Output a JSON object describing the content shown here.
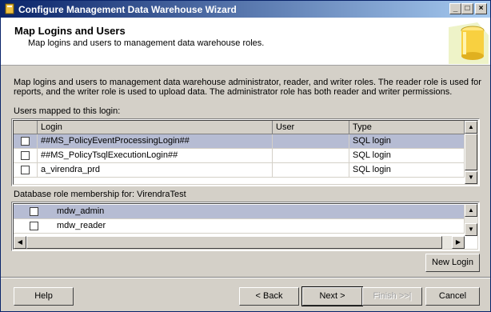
{
  "window": {
    "title": "Configure Management Data Warehouse Wizard",
    "controls": {
      "minimize": "_",
      "maximize": "□",
      "close": "×"
    }
  },
  "header": {
    "title": "Map Logins and Users",
    "subtitle": "Map logins and users to management data warehouse roles."
  },
  "description": "Map logins and users to management data warehouse administrator, reader, and writer roles. The reader role is used for reports, and the writer role is used to upload data. The administrator role has both reader and writer permissions.",
  "users_section": {
    "label": "Users mapped to this login:",
    "columns": [
      "",
      "Login",
      "User",
      "Type"
    ],
    "rows": [
      {
        "checked": false,
        "login": "##MS_PolicyEventProcessingLogin##",
        "user": "",
        "type": "SQL login",
        "selected": true
      },
      {
        "checked": false,
        "login": "##MS_PolicyTsqlExecutionLogin##",
        "user": "",
        "type": "SQL login",
        "selected": false
      },
      {
        "checked": false,
        "login": "a_virendra_prd",
        "user": "",
        "type": "SQL login",
        "selected": false
      }
    ]
  },
  "roles_section": {
    "label": "Database role membership for: VirendraTest",
    "rows": [
      {
        "checked": false,
        "role": "mdw_admin",
        "selected": true
      },
      {
        "checked": false,
        "role": "mdw_reader",
        "selected": false
      }
    ]
  },
  "buttons": {
    "new_login": "New Login",
    "help": "Help",
    "back": "< Back",
    "next": "Next >",
    "finish": "Finish >>|",
    "cancel": "Cancel"
  },
  "colors": {
    "titlebar_start": "#0a246a",
    "titlebar_end": "#a6caf0",
    "selection": "#b6bcd3",
    "dialog_bg": "#d4d0c8"
  },
  "icons": [
    "app-icon",
    "warehouse-cylinder-icon",
    "scroll-up-icon",
    "scroll-down-icon",
    "scroll-left-icon",
    "scroll-right-icon"
  ]
}
